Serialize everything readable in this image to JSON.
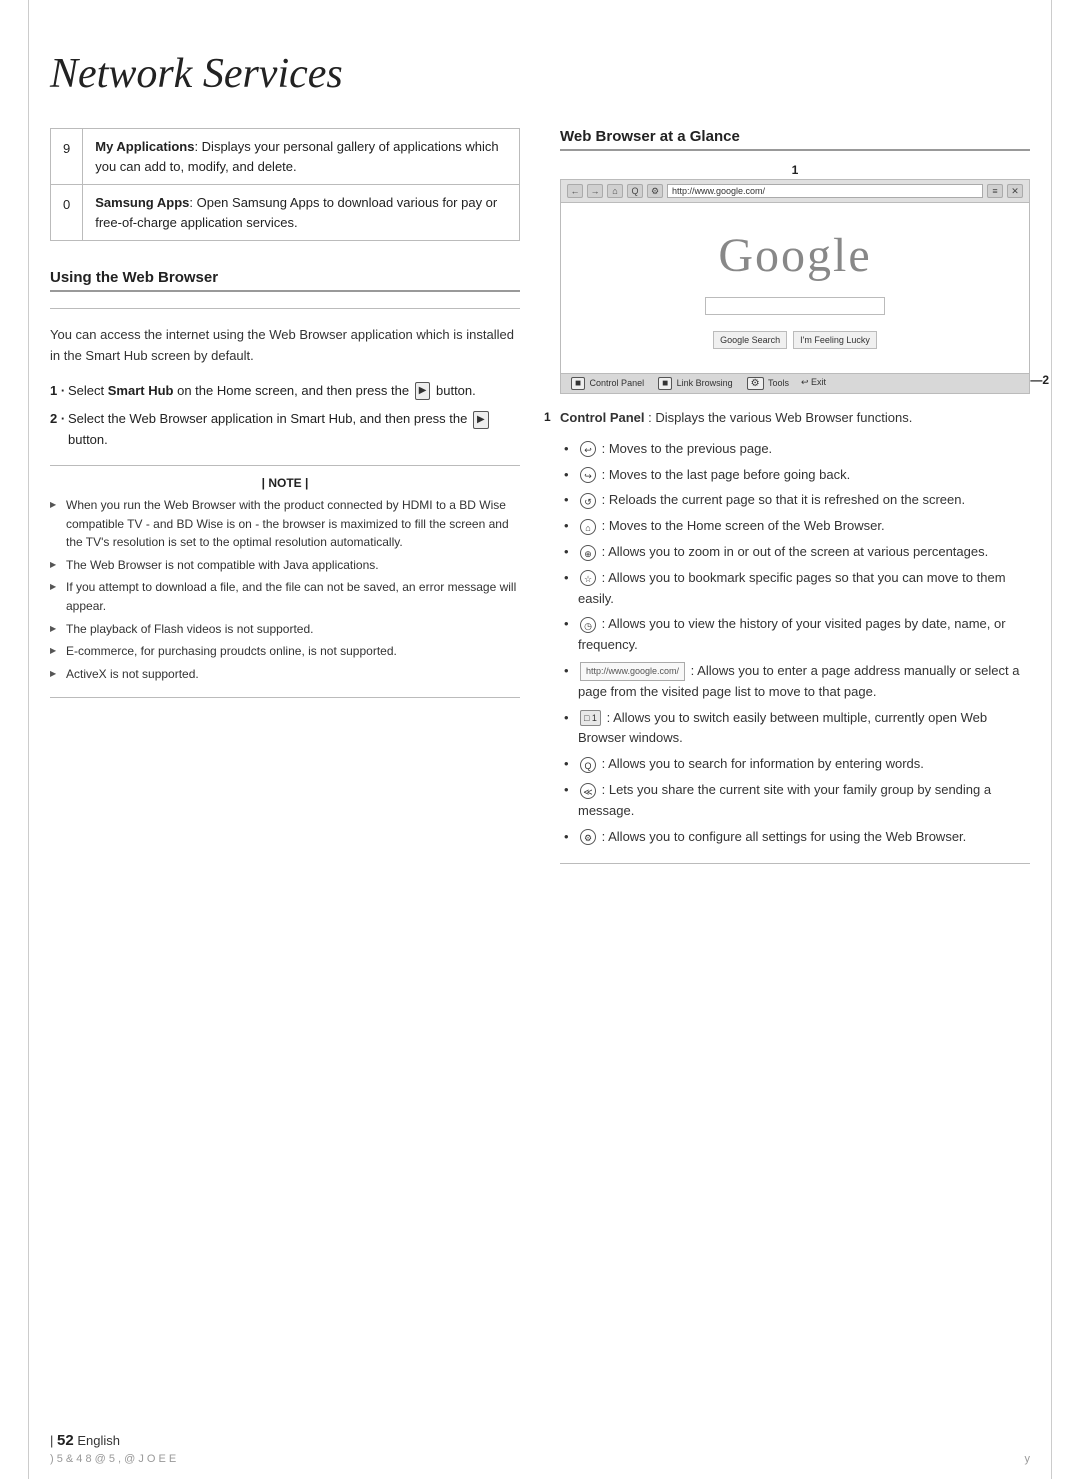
{
  "page": {
    "title": "Network Services",
    "footer_num": "52",
    "footer_lang": "English",
    "footer_bottom_left": ") 5 & 4   8 @ 5 , @   J O E E",
    "footer_bottom_right": "y"
  },
  "table_items": [
    {
      "num": "9",
      "label": "My Applications",
      "desc": ": Displays your personal gallery of applications which you can add to, modify, and delete."
    },
    {
      "num": "0",
      "label": "Samsung Apps",
      "desc": ": Open Samsung Apps to download various for pay or free-of-charge application services."
    }
  ],
  "left_section": {
    "title": "Using the Web Browser",
    "intro": "You can access the internet using the Web Browser application which is installed in the Smart Hub screen by default.",
    "steps": [
      {
        "num": "1",
        "text": "Select Smart Hub on the Home screen, and then press the",
        "icon": "▶",
        "text2": "button."
      },
      {
        "num": "2",
        "text": "Select the Web Browser application in Smart Hub, and then press the",
        "icon": "▶",
        "text2": "button."
      }
    ],
    "note_title": "| NOTE |",
    "notes": [
      "When you run the Web Browser with the product connected by HDMI to a BD Wise compatible TV - and BD Wise is on - the browser is maximized to fill the screen and the TV's resolution is set to the optimal resolution automatically.",
      "The Web Browser is not compatible with Java applications.",
      "If you attempt to download a file, and the file can not be saved, an error message will appear.",
      "The playback of Flash videos is not supported.",
      "E-commerce, for purchasing proudcts online, is not supported.",
      "ActiveX is not supported."
    ]
  },
  "right_section": {
    "title": "Web Browser at a Glance",
    "browser": {
      "url": "http://www.google.com/",
      "google_logo": "Google",
      "btn1": "Google Search",
      "btn2": "I'm Feeling Lucky",
      "footer_items": [
        "Control Panel",
        "Link Browsing",
        "Tools",
        "Exit"
      ]
    },
    "callout_1": "1",
    "callout_2": "2",
    "callout_side_1": "1",
    "control_panel_label": "Control Panel",
    "control_panel_desc": ": Displays the various Web Browser functions.",
    "bullets": [
      {
        "icon_type": "circle",
        "icon_char": "↩",
        "text": ": Moves to the previous page."
      },
      {
        "icon_type": "circle",
        "icon_char": "↪",
        "text": ": Moves to the last page before going back."
      },
      {
        "icon_type": "circle",
        "icon_char": "↺",
        "text": ": Reloads the current page so that it is refreshed on the screen."
      },
      {
        "icon_type": "circle",
        "icon_char": "⌂",
        "text": ": Moves to the Home screen of the Web Browser."
      },
      {
        "icon_type": "circle",
        "icon_char": "⊕",
        "text": ": Allows you to zoom in or out of the screen at various percentages."
      },
      {
        "icon_type": "circle",
        "icon_char": "☆",
        "text": ": Allows you to bookmark specific pages so that you can move to them easily."
      },
      {
        "icon_type": "circle",
        "icon_char": "◷",
        "text": ": Allows you to view the history of your visited pages by date, name, or frequency."
      },
      {
        "icon_type": "url_box",
        "icon_char": "http://www.google.com/",
        "text": ": Allows you to enter a page address manually or select a page from the visited page list to move to that page."
      },
      {
        "icon_type": "tab_box",
        "icon_char": "□ 1",
        "text": ": Allows you to switch easily between multiple, currently open Web Browser windows."
      },
      {
        "icon_type": "circle",
        "icon_char": "Q",
        "text": ": Allows you to search for information by entering words."
      },
      {
        "icon_type": "circle",
        "icon_char": "≪",
        "text": ": Lets you share the current site with your family group by sending a message."
      },
      {
        "icon_type": "circle",
        "icon_char": "⚙",
        "text": ": Allows you to configure all settings for using the Web Browser."
      }
    ]
  }
}
